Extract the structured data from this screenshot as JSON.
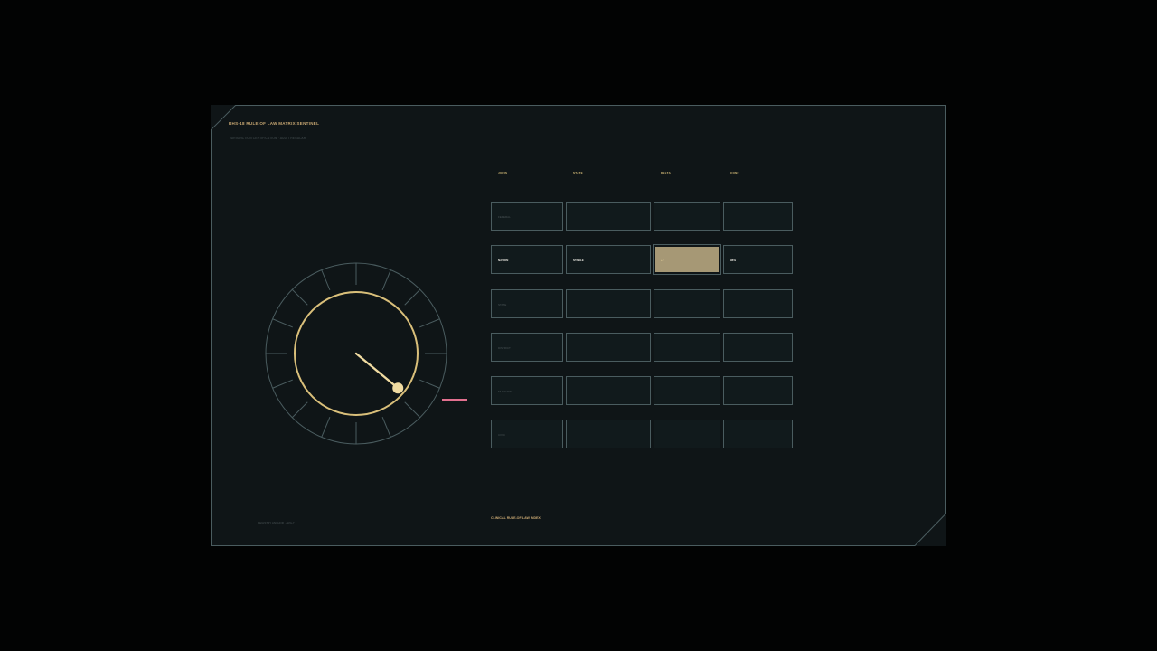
{
  "app": {
    "title": "RHS-18 RULE OF LAW MATRIX SENTINEL",
    "subtitle": "JURISDICTION CERTIFICATION · AUDIT REGULAR",
    "footer_left": "REGISTRY ANCHOR · ARG-7",
    "footer_index": "CLINICAL RULE-OF-LAW INDEX"
  },
  "colors": {
    "background": "#020303",
    "panel": "#0f1517",
    "frame": "#4a5c5f",
    "accent_gold": "#d9bf7a",
    "title_gold": "#c9a873",
    "highlight_fill": "#a69875",
    "needle": "#f0dba1",
    "pink": "#e2708f",
    "muted_text": "#4a5456",
    "white_text": "#e8e6df"
  },
  "matrix": {
    "headers": [
      "JURIS",
      "STATE",
      "DELTA",
      "CONF"
    ],
    "rows": [
      {
        "label": "FEDERAL",
        "state": "",
        "delta": "",
        "conf": "",
        "active": false
      },
      {
        "label": "NATION",
        "state": "STABLE",
        "delta": "+2",
        "conf": "96%",
        "active": true
      },
      {
        "label": "STATE",
        "state": "",
        "delta": "",
        "conf": "",
        "active": false
      },
      {
        "label": "DISTRICT",
        "state": "",
        "delta": "",
        "conf": "",
        "active": false
      },
      {
        "label": "MUNICIPAL",
        "state": "",
        "delta": "",
        "conf": "",
        "active": false
      },
      {
        "label": "CIVIC",
        "state": "",
        "delta": "",
        "conf": "",
        "active": false
      }
    ]
  },
  "gauge": {
    "tick_count": 16,
    "needle_value": 0.36
  }
}
